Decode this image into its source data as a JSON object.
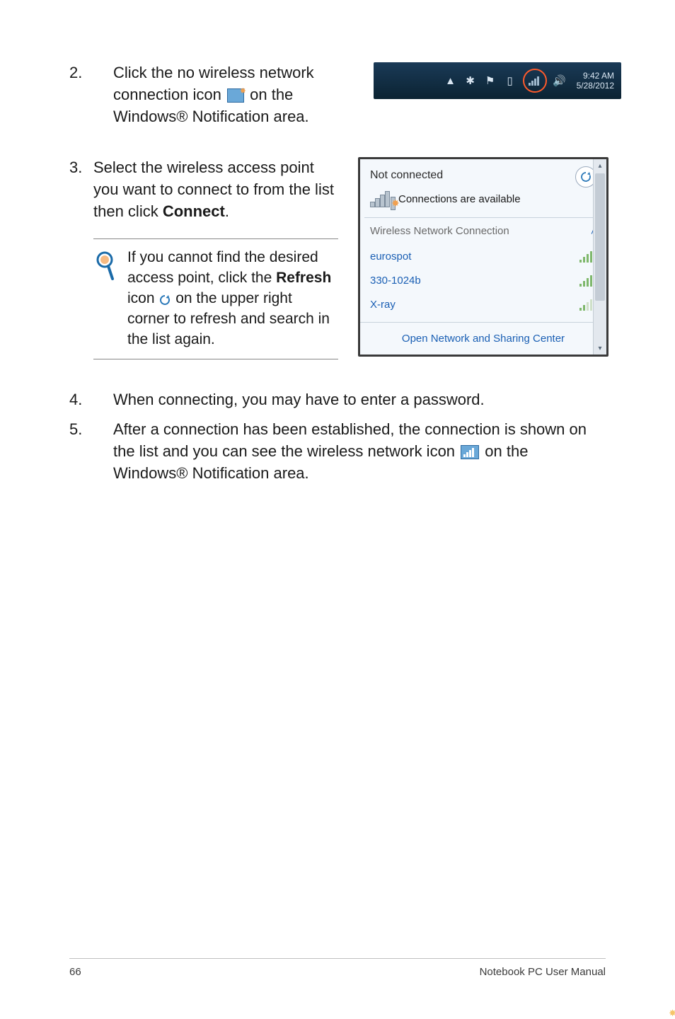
{
  "step2": {
    "num": "2.",
    "text_a": "Click the no wireless network connection icon ",
    "text_b": " on the Windows® Notification area."
  },
  "tray": {
    "time": "9:42 AM",
    "date": "5/28/2012"
  },
  "step3": {
    "num": "3.",
    "text_a": "Select the wireless access point you want to connect to from the list then click ",
    "bold": "Connect",
    "text_b": "."
  },
  "note": {
    "a": "If you cannot find the desired access point, click the ",
    "bold": "Refresh",
    "b": " icon ",
    "c": " on the upper right corner to refresh and search in the list again."
  },
  "flyout": {
    "not_connected": "Not connected",
    "avail": "Connections are available",
    "wnc": "Wireless Network Connection",
    "nets": [
      "eurospot",
      "330-1024b",
      "X-ray"
    ],
    "footer": "Open Network and Sharing Center"
  },
  "step4": {
    "num": "4.",
    "text": "When connecting, you may have to enter a password."
  },
  "step5": {
    "num": "5.",
    "a": "After a connection has been established, the connection is shown on the list and you can see the wireless network icon ",
    "b": " on the Windows® Notification area."
  },
  "footer": {
    "page": "66",
    "title": "Notebook PC User Manual"
  }
}
